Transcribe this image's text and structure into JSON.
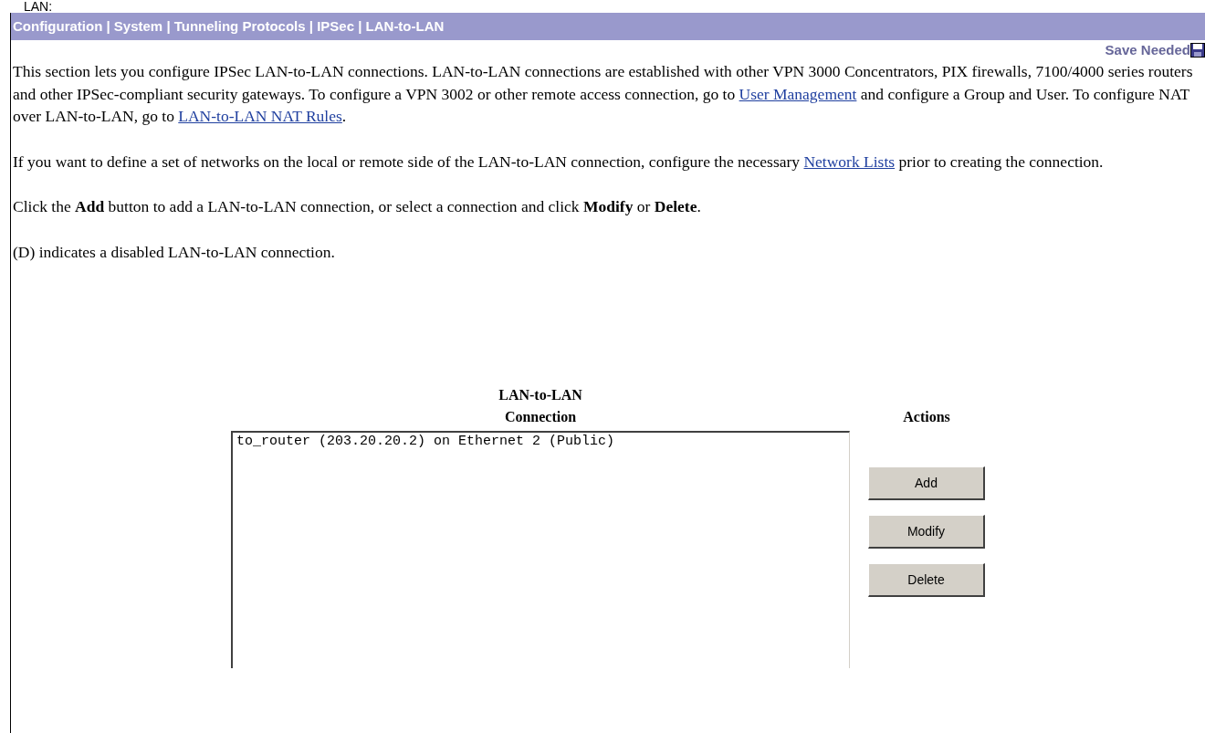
{
  "cutoff_heading": "LAN:",
  "breadcrumb": "Configuration | System | Tunneling Protocols | IPSec | LAN-to-LAN",
  "save_status": "Save Needed",
  "paragraphs": [
    [
      {
        "kind": "text",
        "text": "This section lets you configure IPSec LAN-to-LAN connections. LAN-to-LAN connections are established with other VPN 3000 Concentrators, PIX firewalls, 7100/4000 series routers and other IPSec-compliant security gateways. To configure a VPN 3002 or other remote access connection, go to "
      },
      {
        "kind": "link",
        "text": "User Management"
      },
      {
        "kind": "text",
        "text": " and configure a Group and User. To configure NAT over LAN-to-LAN, go to "
      },
      {
        "kind": "link",
        "text": "LAN-to-LAN NAT Rules"
      },
      {
        "kind": "text",
        "text": "."
      }
    ],
    [
      {
        "kind": "text",
        "text": "If you want to define a set of networks on the local or remote side of the LAN-to-LAN connection, configure the necessary "
      },
      {
        "kind": "link",
        "text": "Network Lists"
      },
      {
        "kind": "text",
        "text": " prior to creating the connection."
      }
    ],
    [
      {
        "kind": "text",
        "text": "Click the **Add** button to add a LAN-to-LAN connection, or select a connection and click **Modify** or **Delete**."
      }
    ],
    [
      {
        "kind": "text",
        "text": "(D) indicates a disabled LAN-to-LAN connection."
      }
    ]
  ],
  "connections": {
    "heading": [
      "LAN-to-LAN",
      "Connection"
    ],
    "items": [
      {
        "text": "to_router (203.20.20.2) on Ethernet 2 (Public)",
        "selected": false
      }
    ]
  },
  "actions": {
    "heading": "Actions",
    "buttons": [
      "Add",
      "Modify",
      "Delete"
    ]
  }
}
